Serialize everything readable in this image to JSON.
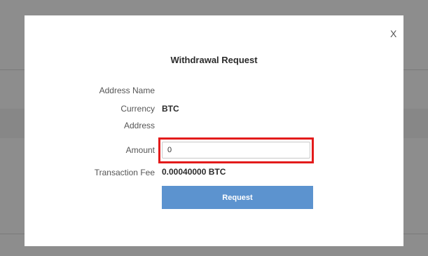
{
  "modal": {
    "close_label": "X",
    "title": "Withdrawal Request",
    "fields": {
      "address_name_label": "Address Name",
      "currency_label": "Currency",
      "currency_value": "BTC",
      "address_label": "Address",
      "amount_label": "Amount",
      "amount_value": "0",
      "transaction_fee_label": "Transaction Fee",
      "transaction_fee_value": "0.00040000 BTC"
    },
    "request_button_label": "Request"
  },
  "colors": {
    "overlay": "#8a8a8a",
    "button": "#5c93cf",
    "highlight": "#e31b1b"
  }
}
